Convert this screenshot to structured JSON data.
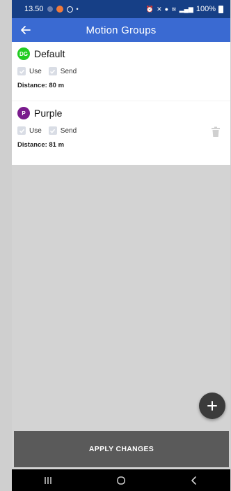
{
  "status_bar": {
    "time": "13.50",
    "battery": "100%"
  },
  "app_bar": {
    "title": "Motion Groups"
  },
  "groups": [
    {
      "avatar_text": "DG",
      "avatar_color": "#22cc22",
      "name": "Default",
      "use_label": "Use",
      "send_label": "Send",
      "distance": "Distance: 80 m"
    },
    {
      "avatar_text": "P",
      "avatar_color": "#7a1b8d",
      "name": "Purple",
      "use_label": "Use",
      "send_label": "Send",
      "distance": "Distance: 81 m"
    }
  ],
  "apply_button": {
    "label": "APPLY CHANGES"
  },
  "colors": {
    "status_bar": "#163f86",
    "app_bar": "#3a6ad2",
    "fab": "#3b3b3b",
    "apply": "#5a5a5a"
  },
  "icons": [
    "back-arrow-icon",
    "trash-icon",
    "plus-icon",
    "recent-apps-icon",
    "home-icon",
    "back-nav-icon"
  ]
}
